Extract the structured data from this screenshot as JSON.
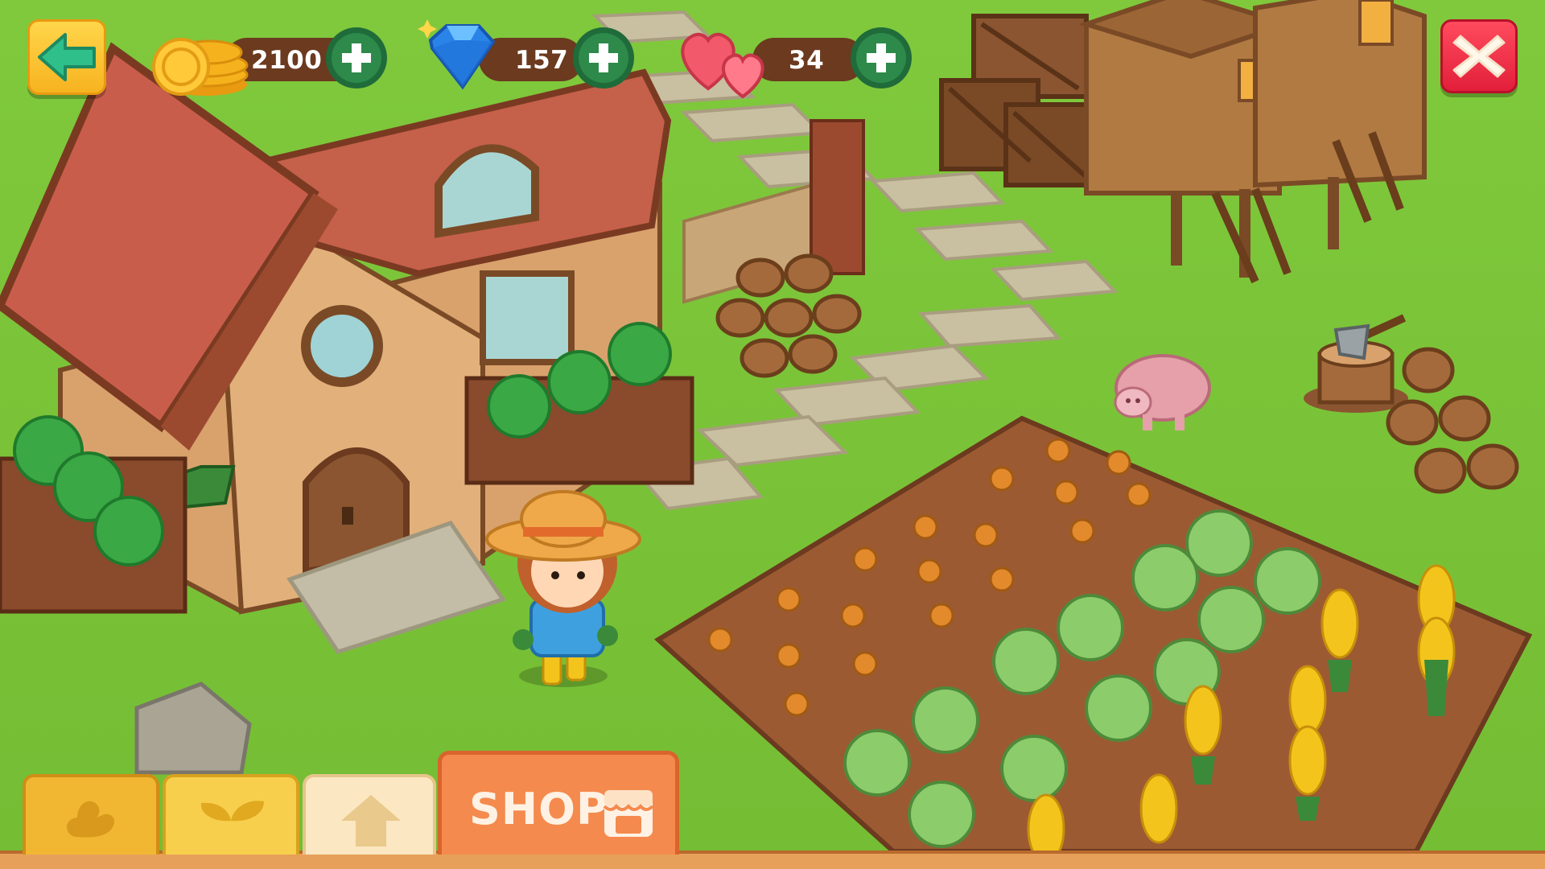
{
  "hud": {
    "back_icon": "arrow-left-icon",
    "close_icon": "close-x-icon",
    "coins": {
      "icon": "coin-stack-icon",
      "value": "2100"
    },
    "gems": {
      "icon": "diamond-icon",
      "value": "157"
    },
    "lives": {
      "icon": "hearts-icon",
      "value": "34"
    }
  },
  "toolbar": {
    "tabs": [
      {
        "id": "animals",
        "icon": "duck-icon"
      },
      {
        "id": "crops",
        "icon": "sprout-icon"
      },
      {
        "id": "upgrade",
        "icon": "house-arrow-icon"
      },
      {
        "id": "shop",
        "label": "SHOP",
        "icon": "shop-stall-icon"
      }
    ]
  },
  "colors": {
    "grass": "#7cc63a",
    "soil": "#9c5a33",
    "wood": "#7a4a26",
    "coin_gold": "#f6b21c",
    "gem_blue": "#2a84e8",
    "heart_red": "#f25a6c",
    "plus_green": "#2d8a4a",
    "shop_orange": "#f58a4e"
  }
}
